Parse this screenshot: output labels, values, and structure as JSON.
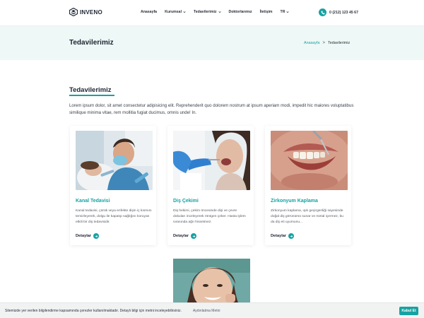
{
  "header": {
    "logo_text": "INVENO",
    "nav": [
      {
        "label": "Anasayfa",
        "dropdown": false
      },
      {
        "label": "Kurumsal",
        "dropdown": true
      },
      {
        "label": "Tedavilerimiz",
        "dropdown": true
      },
      {
        "label": "Doktorlarımız",
        "dropdown": false
      },
      {
        "label": "İletişim",
        "dropdown": false
      },
      {
        "label": "TR",
        "dropdown": true
      }
    ],
    "phone": "0 (212) 123 45 67"
  },
  "banner": {
    "title": "Tedavilerimiz",
    "breadcrumb": {
      "home": "Anasayfa",
      "separator": ">",
      "current": "Tedavilerimiz"
    }
  },
  "section": {
    "title": "Tedavilerimiz",
    "description": "Lorem ipsum dolor, sit amet consectetur adipisicing elit. Reprehenderit quo dolorem nostrum at ipsum aperiam modi, impedit hic maiores voluptatibus similique minima vitae, rem mollitia fugiat ducimus, omnis unde! In."
  },
  "cards": [
    {
      "title": "Kanal Tedavisi",
      "text": "Kanal tedavisi, çürük veya enfekte dişin iç kısmını temizleyerek, dolgu ile kapatıp sağlığını koruyan etkili bir diş tedavisidir.",
      "link": "Detaylar"
    },
    {
      "title": "Diş Çekimi",
      "text": "Diş hekimi, çekim öncesinde dişi ve çevre dokuları inceleyerek röntgen çeker. Hasta işlem sırasında ağrı hissetmez.",
      "link": "Detaylar"
    },
    {
      "title": "Zirkonyum Kaplama",
      "text": "Zirkonyum kaplama, ışık geçirgenliği sayesinde doğal diş görünümü sunar ve metal içermez, bu da diş eti uyumunu...",
      "link": "Detaylar"
    }
  ],
  "cookie": {
    "text": "Sitemizde yer verilen bilgilendirme kapsamında çerezler kullanılmaktadır. Detaylı bilgi için metni inceleyebilirsiniz.",
    "link": "Aydınlatma Metni",
    "button": "Kabul Et"
  },
  "colors": {
    "accent": "#17a2a2",
    "banner_bg": "#eef8f6",
    "heading": "#1d2433"
  }
}
